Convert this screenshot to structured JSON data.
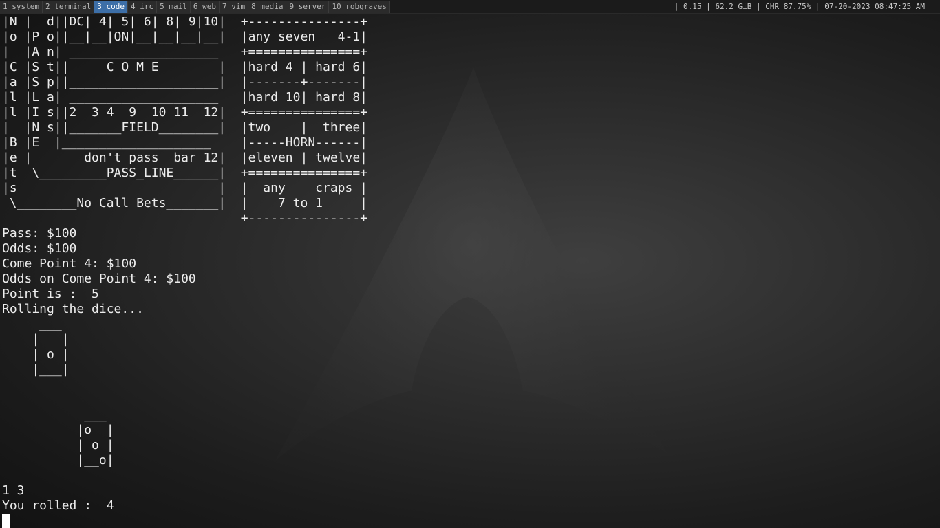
{
  "topbar": {
    "workspaces": [
      {
        "label": "1 system",
        "active": false
      },
      {
        "label": "2 terminal",
        "active": false
      },
      {
        "label": "3 code",
        "active": true
      },
      {
        "label": "4 irc",
        "active": false
      },
      {
        "label": "5 mail",
        "active": false
      },
      {
        "label": "6 web",
        "active": false
      },
      {
        "label": "7 vim",
        "active": false
      },
      {
        "label": "8 media",
        "active": false
      },
      {
        "label": "9 server",
        "active": false
      },
      {
        "label": "10 robgraves",
        "active": false
      }
    ],
    "status": "| 0.15 | 62.2 GiB | CHR 87.75% | 07-20-2023 08:47:25 AM"
  },
  "colors": {
    "active_workspace": "#3d6fa8",
    "terminal_text": "#ececec",
    "cursor": "#ffffff"
  },
  "terminal": {
    "lines": [
      "|N |  d||DC| 4| 5| 6| 8| 9|10|  +---------------+",
      "|o |P o||__|__|ON|__|__|__|__|  |any seven   4-1|",
      "|  |A n| ____________________   +===============+",
      "|C |S t||     C O M E        |  |hard 4 | hard 6|",
      "|a |S p||____________________|  |-------+-------|",
      "|l |L a| ____________________   |hard 10| hard 8|",
      "|l |I s||2  3 4  9  10 11  12|  +===============+",
      "|  |N s||_______FIELD________|  |two    |  three|",
      "|B |E  |____________________    |-----HORN------|",
      "|e |       don't pass  bar 12|  |eleven | twelve|",
      "|t  \\_________PASS_LINE______|  +===============+",
      "|s                           |  |  any    craps |",
      " \\________No Call Bets_______|  |    7 to 1     |",
      "                                +---------------+",
      "Pass: $100",
      "Odds: $100",
      "Come Point 4: $100",
      "Odds on Come Point 4: $100",
      "Point is :  5",
      "Rolling the dice...",
      "     ___",
      "    |   |",
      "    | o |",
      "    |___|",
      "",
      "",
      "           ___",
      "          |o  |",
      "          | o |",
      "          |__o|",
      "",
      "1 3",
      "You rolled :  4"
    ],
    "prompt": ""
  }
}
